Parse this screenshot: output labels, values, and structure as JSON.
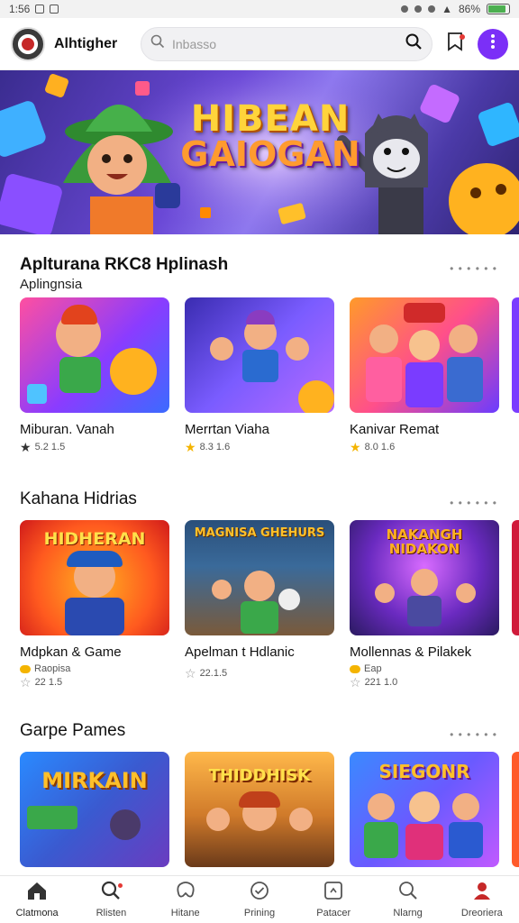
{
  "status_bar": {
    "time": "1:56",
    "battery": "86%",
    "battery_level": 0.86
  },
  "header": {
    "app_name": "Alhtigher",
    "search_placeholder": "Inbasso",
    "icons": [
      "app-logo",
      "search-icon",
      "search-submit-icon",
      "bookmark-icon",
      "more-vert-icon"
    ]
  },
  "hero": {
    "title_line1": "HIBEAN",
    "title_line2": "GAIOGAN"
  },
  "sections": [
    {
      "title": "Aplturana RKC8 Hplinash",
      "subtitle": "Aplingnsia",
      "cards": [
        {
          "name": "Miburan. Vanah",
          "rating": "5.2 1.5",
          "star_color": "#333333"
        },
        {
          "name": "Merrtan Viaha",
          "rating": "8.3 1.6",
          "star_color": "#f4b400"
        },
        {
          "name": "Kanivar Remat",
          "rating": "8.0 1.6",
          "star_color": "#f4b400"
        }
      ]
    },
    {
      "title": "Kahana Hidrias",
      "subtitle": "",
      "cards": [
        {
          "name": "Mdpkan & Game",
          "tag": "Raopisa",
          "rating": "22 1.5",
          "star_color": "#999999"
        },
        {
          "name": "Apelman t Hdlanic",
          "tag": "",
          "rating": "22.1.5",
          "star_color": "#999999"
        },
        {
          "name": "Mollennas & Pilakek",
          "tag": "Eap",
          "rating": "221 1.0",
          "star_color": "#999999"
        }
      ]
    },
    {
      "title": "Garpe Pames",
      "subtitle": "",
      "cards": [
        {
          "name": "Mirkain",
          "thumb_title": "MIRKAIN"
        },
        {
          "name": "Thiddhisk",
          "thumb_title": "THIDDHISK"
        },
        {
          "name": "Siegonr",
          "thumb_title": "SIEGONR"
        }
      ]
    }
  ],
  "card_thumbs_section2": [
    "HIDHERAN",
    "MAGNISA GHEHURS",
    "NAKANGH NIDAKON"
  ],
  "bottom_nav": [
    {
      "label": "Clatmona",
      "icon": "home-icon",
      "active": true
    },
    {
      "label": "Rlisten",
      "icon": "search-icon",
      "badge": true
    },
    {
      "label": "Hitane",
      "icon": "games-icon"
    },
    {
      "label": "Prining",
      "icon": "check-circle-icon"
    },
    {
      "label": "Patacer",
      "icon": "apps-icon"
    },
    {
      "label": "Nlarng",
      "icon": "search-icon"
    },
    {
      "label": "Dreoriera",
      "icon": "profile-icon"
    }
  ],
  "colors": {
    "accent": "#7b2ff7",
    "active_nav": "#c62828",
    "star": "#f4b400"
  }
}
